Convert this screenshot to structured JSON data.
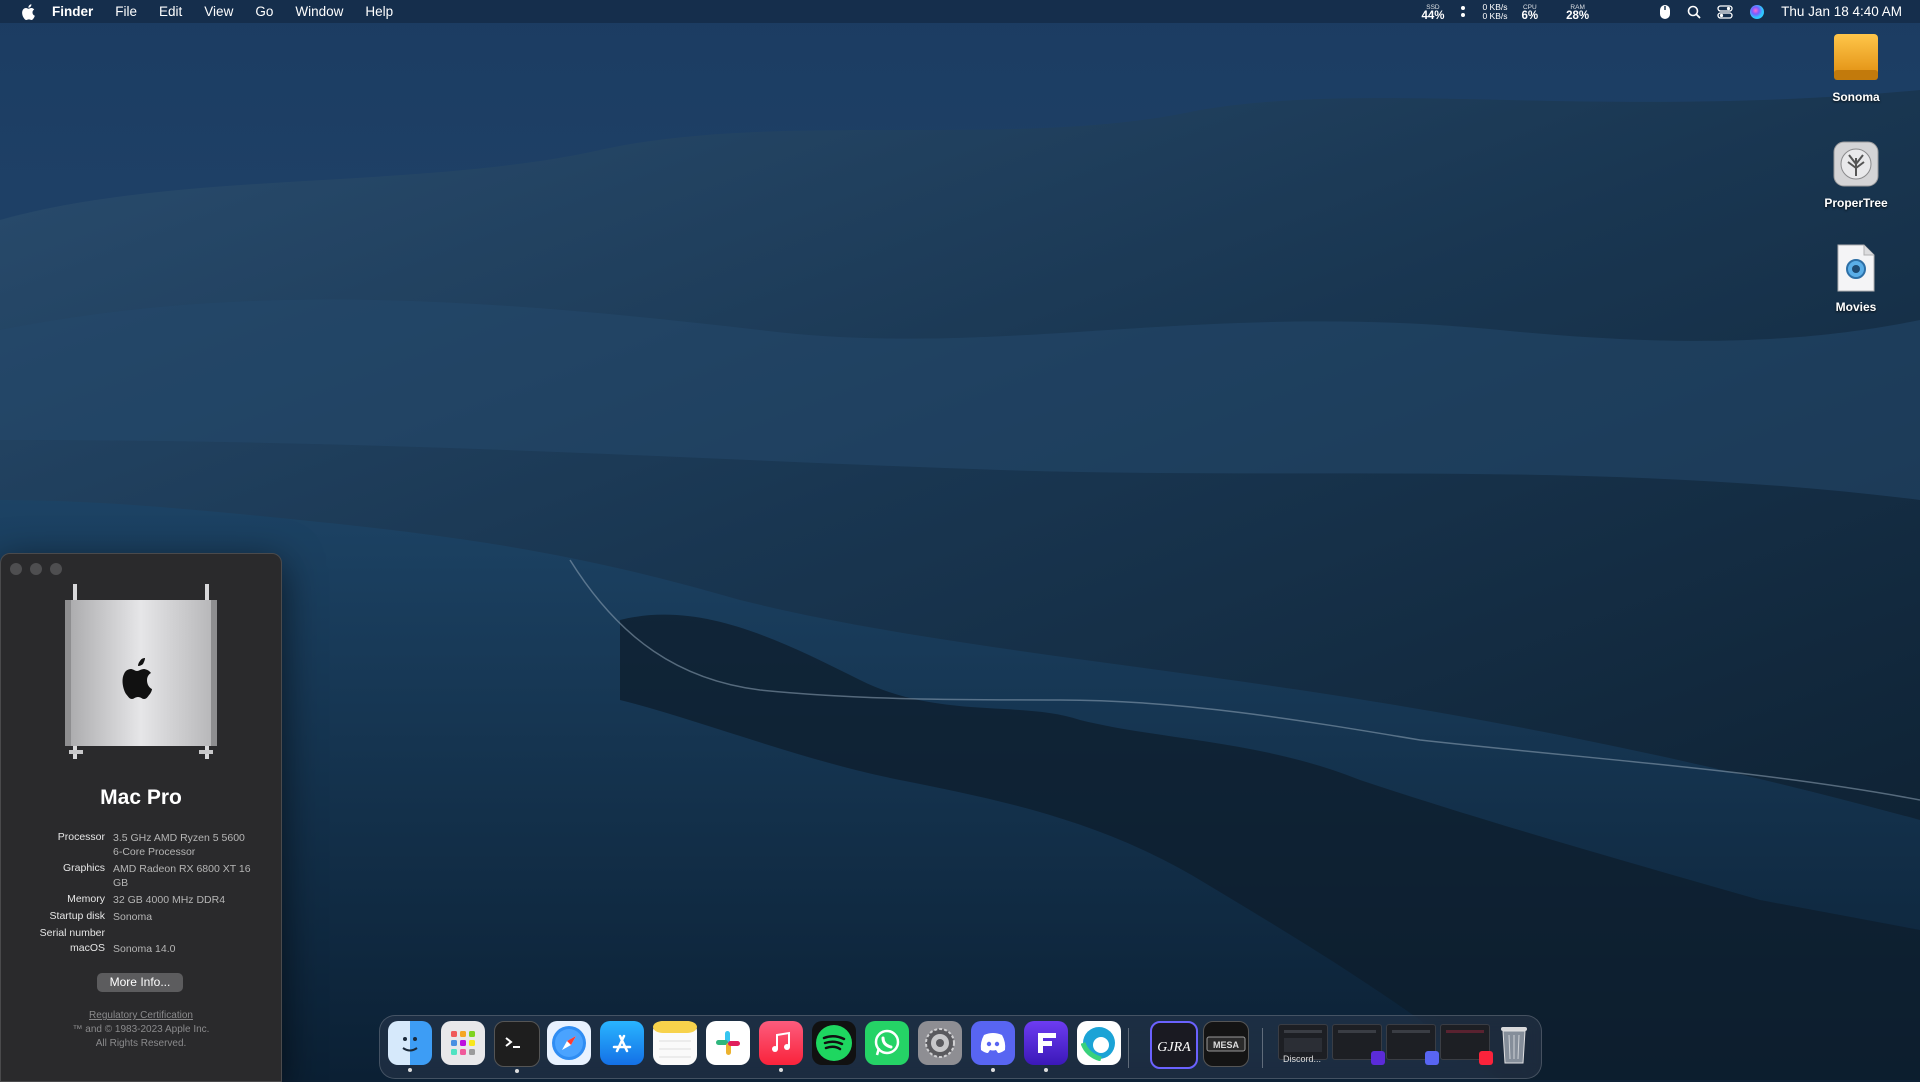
{
  "menubar": {
    "app_name": "Finder",
    "menus": [
      "File",
      "Edit",
      "View",
      "Go",
      "Window",
      "Help"
    ],
    "ssd": {
      "label": "SSD",
      "value": "44%"
    },
    "network": {
      "up": "0 KB/s",
      "down": "0 KB/s"
    },
    "cpu": {
      "label": "CPU",
      "value": "6%"
    },
    "ram": {
      "label": "RAM",
      "value": "28%"
    },
    "clock": "Thu Jan 18  4:40 AM"
  },
  "desktop_icons": [
    {
      "label": "Sonoma",
      "icon": "drive-icon"
    },
    {
      "label": "ProperTree",
      "icon": "propertree-icon"
    },
    {
      "label": "Movies",
      "icon": "movie-file-icon"
    }
  ],
  "about": {
    "model": "Mac Pro",
    "specs": [
      {
        "key": "Processor",
        "value": "3.5 GHz AMD Ryzen 5 5600 6-Core Processor"
      },
      {
        "key": "Graphics",
        "value": "AMD Radeon RX 6800 XT 16 GB"
      },
      {
        "key": "Memory",
        "value": "32 GB 4000 MHz DDR4"
      },
      {
        "key": "Startup disk",
        "value": "Sonoma"
      },
      {
        "key": "Serial number",
        "value": ""
      },
      {
        "key": "macOS",
        "value": "Sonoma 14.0"
      }
    ],
    "more_info_label": "More Info...",
    "regulatory": "Regulatory Certification",
    "copyright_1": "™ and © 1983-2023 Apple Inc.",
    "copyright_2": "All Rights Reserved."
  },
  "dock": {
    "apps": [
      {
        "name": "Finder",
        "color": "#3d9df5",
        "running": true
      },
      {
        "name": "Launchpad",
        "color": "#e8e8ea",
        "running": false
      },
      {
        "name": "Terminal",
        "color": "#1e1e1e",
        "running": true
      },
      {
        "name": "Safari",
        "color": "#3b8ef0",
        "running": false
      },
      {
        "name": "App Store",
        "color": "#1f8cf5",
        "running": false
      },
      {
        "name": "Notes",
        "color": "#f7d24b",
        "running": false
      },
      {
        "name": "Slack",
        "color": "#ffffff",
        "running": false
      },
      {
        "name": "Music",
        "color": "#fa3b4f",
        "running": true
      },
      {
        "name": "Spotify",
        "color": "#1ed760",
        "running": false
      },
      {
        "name": "WhatsApp",
        "color": "#25d366",
        "running": false
      },
      {
        "name": "System Settings",
        "color": "#8e8e93",
        "running": false
      },
      {
        "name": "Discord",
        "color": "#5865f2",
        "running": true
      },
      {
        "name": "Fig",
        "color": "#5b2bd8",
        "running": true
      },
      {
        "name": "Edge",
        "color": "#1bb4a3",
        "running": false
      },
      {
        "name": "Gojira",
        "color": "#1a1a22",
        "running": false
      },
      {
        "name": "MESA",
        "color": "#141414",
        "running": false
      }
    ],
    "minimized_label": "Discord..."
  }
}
